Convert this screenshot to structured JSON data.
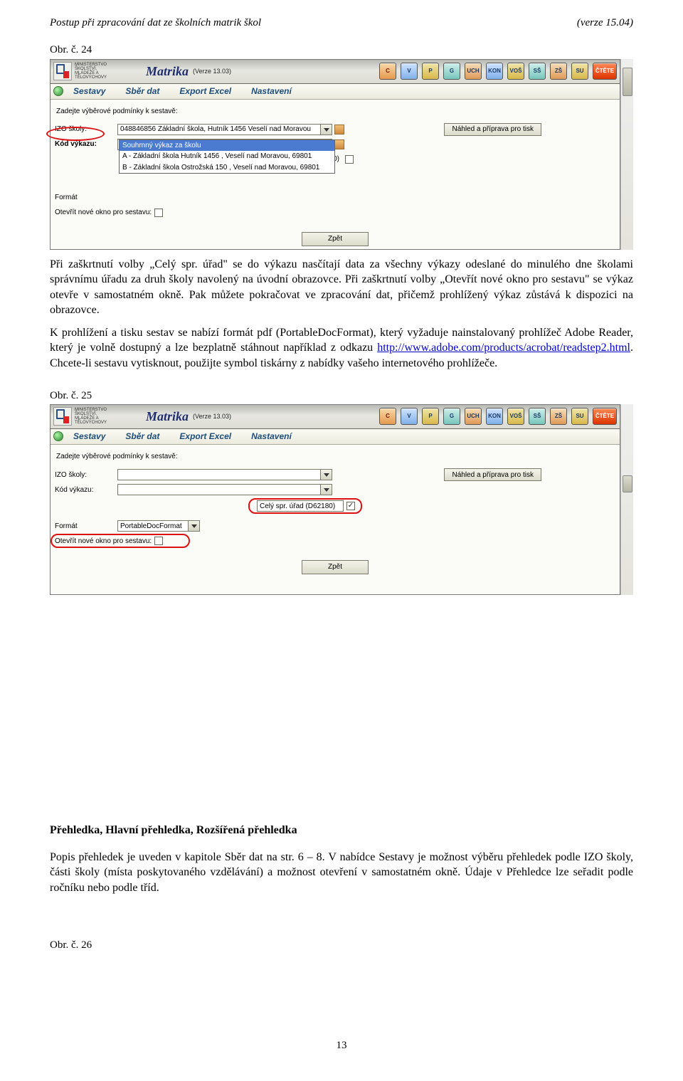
{
  "header": {
    "left": "Postup při zpracování dat ze školních matrik škol",
    "right": "(verze 15.04)"
  },
  "figs": {
    "fig24": "Obr. č. 24",
    "fig25": "Obr. č. 25",
    "fig26": "Obr. č. 26"
  },
  "para1": "Při zaškrtnutí volby „Celý spr. úřad\" se do výkazu nasčítají data za všechny výkazy odeslané do minulého dne školami správnímu úřadu za druh školy navolený na úvodní obrazovce. Při zaškrtnutí volby „Otevřít nové okno pro sestavu\" se výkaz otevře v samostatném okně. Pak můžete pokračovat ve zpracování dat, přičemž prohlížený výkaz zůstává k dispozici na obrazovce.",
  "para2a": "K prohlížení a tisku sestav se nabízí formát pdf (PortableDocFormat), který vyžaduje nainstalovaný prohlížeč Adobe Reader, který je volně dostupný a lze bezplatně stáhnout například z odkazu ",
  "para2_link": "http://www.adobe.com/products/acrobat/readstep2.html",
  "para2b": ". Chcete-li sestavu vytisknout, použijte symbol tiskárny z nabídky vašeho internetového prohlížeče.",
  "subhead": "Přehledka, Hlavní přehledka, Rozšířená přehledka",
  "para3": "Popis přehledek je uveden v kapitole Sběr dat na str. 6 – 8. V nabídce Sestavy je možnost výběru přehledek podle IZO školy, části školy (místa poskytovaného vzdělávání) a možnost otevření v samostatném okně. Údaje v Přehledce lze seřadit podle ročníku nebo podle tříd.",
  "pagenum": "13",
  "app": {
    "ministry_lines": "MINISTERSTVO ŠKOLSTVÍ, MLÁDEŽE A TĚLOVÝCHOVY",
    "title": "Matrika",
    "version": "(Verze 13.03)",
    "tiles": [
      "C",
      "V",
      "P",
      "G",
      "UCH",
      "KON",
      "VOŠ",
      "SŠ",
      "ZŠ",
      "SU",
      "ČTĚTE"
    ],
    "menu": [
      "Sestavy",
      "Sběr dat",
      "Export Excel",
      "Nastavení"
    ],
    "prompt": "Zadejte výběrové podmínky k sestavě:",
    "lbl_izo": "IZO školy:",
    "lbl_kod": "Kód výkazu:",
    "lbl_format": "Formát",
    "lbl_open": "Otevřít nové okno pro sestavu:",
    "izo_value": "048846856 Základní škola, Hutník 1456 Veselí nad Moravou",
    "suffix180": "180)",
    "preview_btn": "Náhled a příprava pro tisk",
    "back": "Zpět",
    "dropdown": [
      "Souhrnný výkaz za školu",
      "A - Základní škola Hutník 1456 , Veselí nad Moravou, 69801",
      "B - Základní škola Ostrožská 150 , Veselí nad Moravou, 69801"
    ],
    "cely_spr": "Celý spr. úřad (D62180)",
    "format_value": "PortableDocFormat"
  }
}
